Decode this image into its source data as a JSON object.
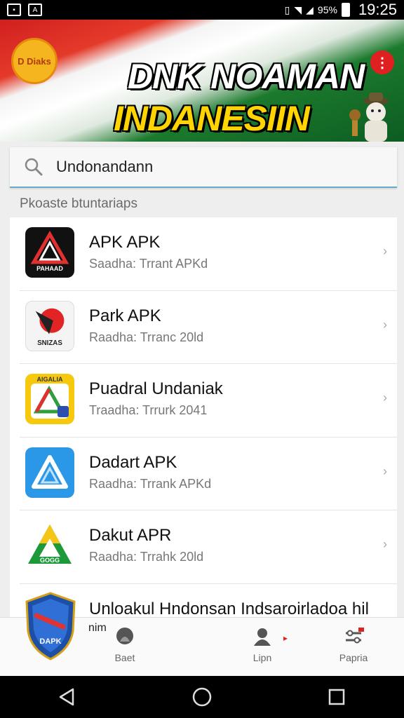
{
  "status_bar": {
    "battery": "95%",
    "time": "19:25"
  },
  "banner": {
    "logo_text": "D Diaks",
    "title_line1": "DNK NOAMAN",
    "title_line2": "INDANESIIN",
    "colors": {
      "red": "#d11f1f",
      "green": "#1b7a2d",
      "yellow": "#ffd400"
    }
  },
  "search": {
    "value": "Undonandann"
  },
  "section": {
    "label": "Pkoaste btuntariaps"
  },
  "apps": [
    {
      "name": "APK APK",
      "subtitle": "Saadha: Trrant APKd",
      "icon": "black-triangle-app-icon",
      "icon_text": "PAHAAD"
    },
    {
      "name": "Park APK",
      "subtitle": "Raadha: Trranc 20ld",
      "icon": "red-p-app-icon",
      "icon_text": "SNIZAS"
    },
    {
      "name": "Puadral Undaniak",
      "subtitle": "Traadha: Trrurk 2041",
      "icon": "yellow-triangle-app-icon",
      "icon_text": "AIGALIA"
    },
    {
      "name": "Dadart APK",
      "subtitle": "Raadha: Trrank APKd",
      "icon": "blue-triangle-app-icon",
      "icon_text": ""
    },
    {
      "name": "Dakut APR",
      "subtitle": "Raadha: Trrahk 20ld",
      "icon": "green-triangle-app-icon",
      "icon_text": "GOGG"
    },
    {
      "name": "Unloakul Hndonsan Indsaroirladoa hil",
      "subtitle": "",
      "icon": "shield-app-icon",
      "icon_text": "DAPK"
    }
  ],
  "bottom_nav": {
    "items": [
      {
        "label": "Baet"
      },
      {
        "label": "Lipn"
      },
      {
        "label": "Papria"
      }
    ],
    "partial_text": "nim"
  }
}
